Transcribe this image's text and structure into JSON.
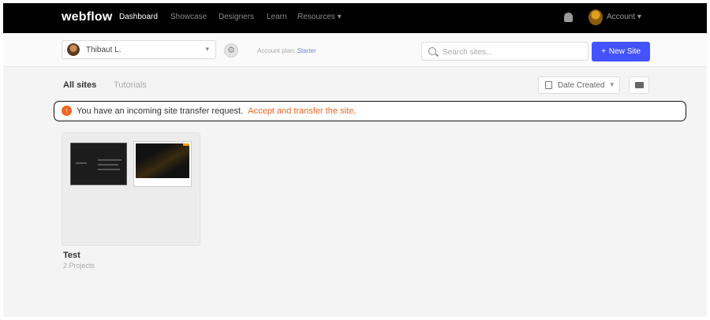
{
  "nav": {
    "logo": "webflow",
    "links": [
      "Dashboard",
      "Showcase",
      "Designers",
      "Learn",
      "Resources ▾"
    ],
    "account_label": "Account ▾"
  },
  "workspace": {
    "name": "Thibaut L.",
    "plan_label": "Account plan:",
    "plan_link": "Starter"
  },
  "search": {
    "placeholder": "Search sites..."
  },
  "new_site_label": "New Site",
  "tabs": [
    "All sites",
    "Tutorials"
  ],
  "sort": {
    "selected": "Date Created"
  },
  "banner": {
    "message": "You have an incoming site transfer request.",
    "link": "Accept and transfer the site."
  },
  "folders": [
    {
      "title": "Test",
      "subtitle": "2 Projects"
    }
  ],
  "colors": {
    "accent_blue": "#4353ff",
    "banner_orange": "#f26522",
    "nav_bg": "#000000"
  }
}
